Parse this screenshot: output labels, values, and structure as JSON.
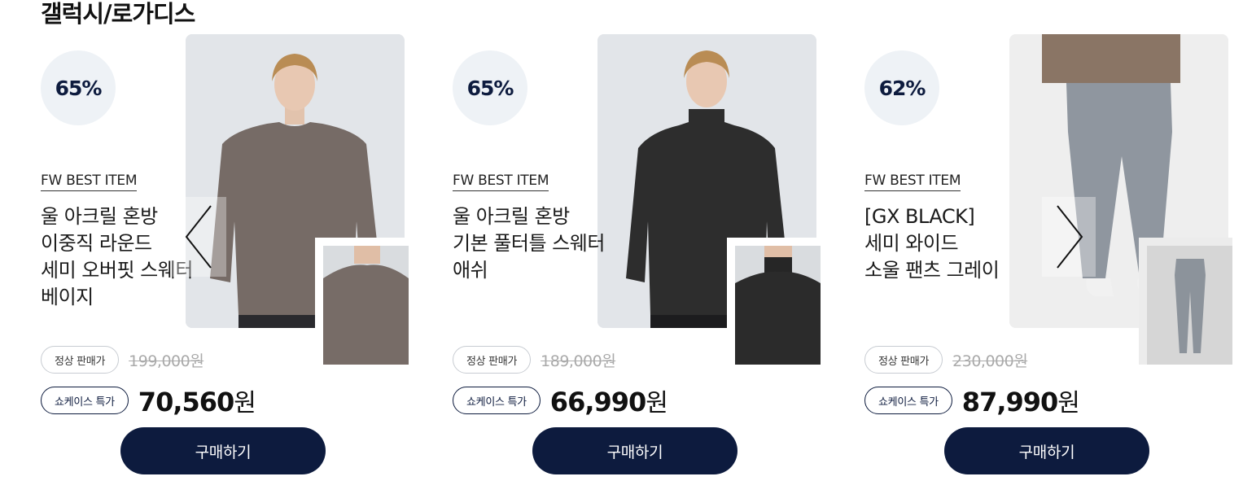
{
  "section": {
    "title": "갤럭시/로가디스"
  },
  "products": [
    {
      "discount": "65%",
      "tag": "FW BEST ITEM",
      "name_lines": [
        "울 아크릴 혼방",
        "이중직 라운드",
        "세미 오버핏 스웨터",
        "베이지"
      ],
      "regular_label": "정상 판매가",
      "regular_price": "199,000원",
      "special_label": "쇼케이스 특가",
      "sale_amount": "70,560",
      "sale_unit": "원",
      "buy_label": "구매하기",
      "garment_color": "#7a6f6a",
      "image": "model-brown-crewneck-sweater"
    },
    {
      "discount": "65%",
      "tag": "FW BEST ITEM",
      "name_lines": [
        "울 아크릴 혼방",
        "기본 풀터틀 스웨터",
        "애쉬"
      ],
      "regular_label": "정상 판매가",
      "regular_price": "189,000원",
      "special_label": "쇼케이스 특가",
      "sale_amount": "66,990",
      "sale_unit": "원",
      "buy_label": "구매하기",
      "garment_color": "#2b2b2b",
      "image": "model-black-turtleneck-sweater"
    },
    {
      "discount": "62%",
      "tag": "FW BEST ITEM",
      "name_lines": [
        "[GX BLACK]",
        "세미 와이드",
        "소울 팬츠 그레이"
      ],
      "regular_label": "정상 판매가",
      "regular_price": "230,000원",
      "special_label": "쇼케이스 특가",
      "sale_amount": "87,990",
      "sale_unit": "원",
      "buy_label": "구매하기",
      "garment_color": "#8e959e",
      "image": "model-grey-wide-pants"
    }
  ],
  "carousel": {
    "prev_icon": "chevron-left-icon",
    "next_icon": "chevron-right-icon"
  }
}
